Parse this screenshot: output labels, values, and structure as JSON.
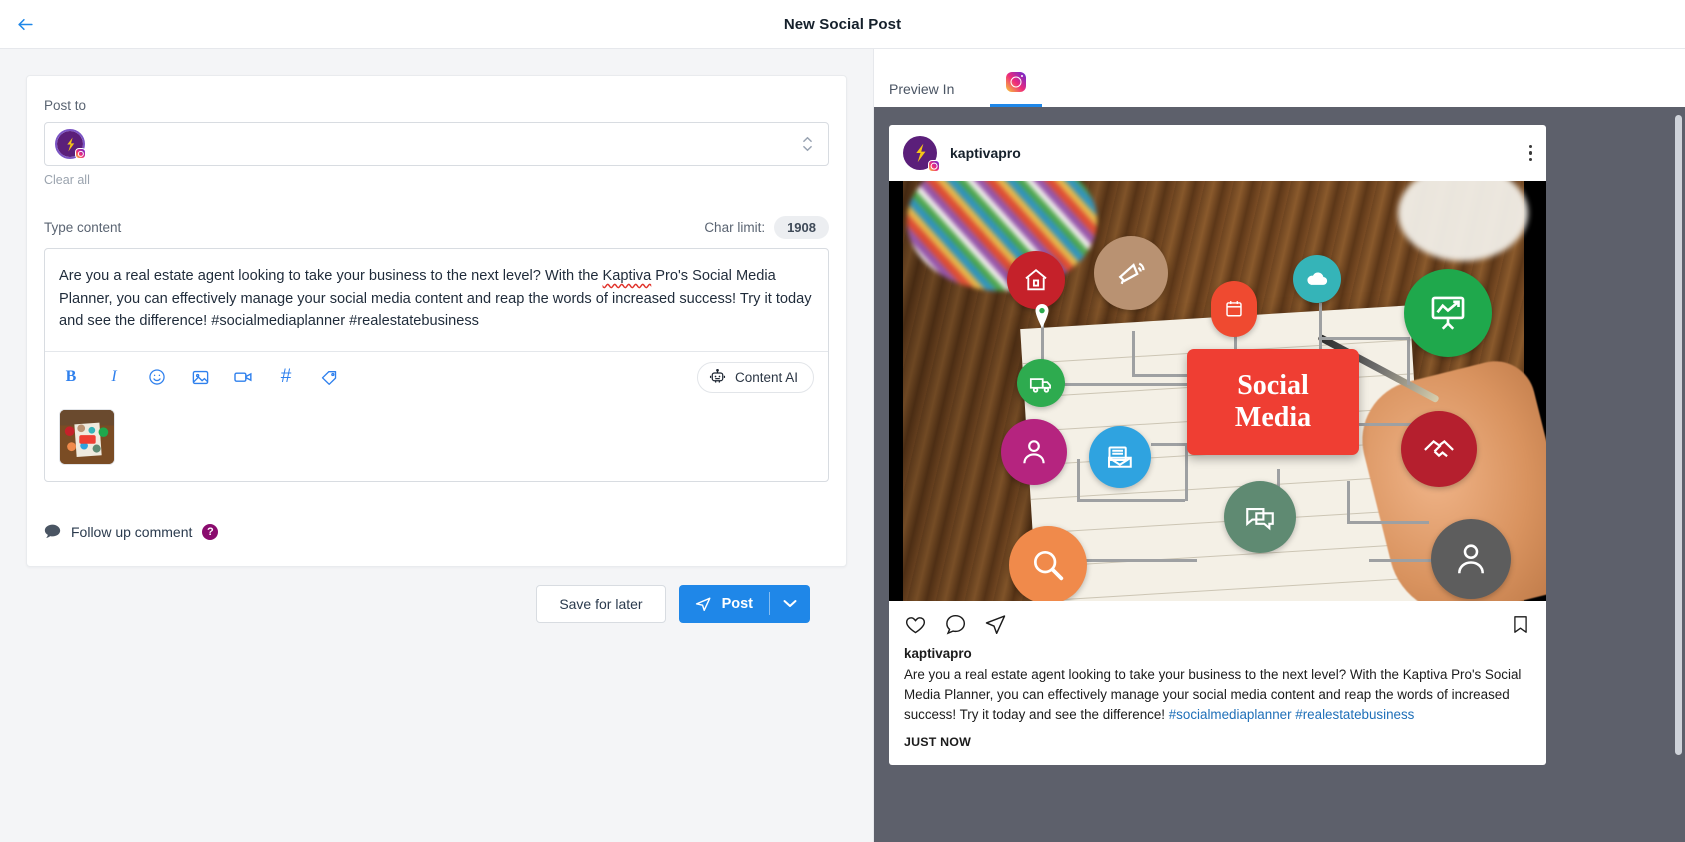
{
  "topbar": {
    "back_icon": "arrow-left-icon",
    "title": "New Social Post"
  },
  "composer": {
    "post_to_label": "Post to",
    "clear_all_label": "Clear all",
    "selected_account_icon": "kaptiva-avatar-instagram",
    "type_content_label": "Type content",
    "char_limit_label": "Char limit:",
    "char_limit_value": "1908",
    "content_text_part1": "Are you a real estate agent looking to take your business to the next level? With the ",
    "content_misspelled_word": "Kaptiva",
    "content_text_part2": " Pro's Social Media Planner, you can effectively manage your social media content and reap the words of increased success! Try it today and see the difference! #socialmediaplanner #realestatebusiness",
    "toolbar": [
      {
        "name": "bold-icon",
        "label": "B"
      },
      {
        "name": "italic-icon",
        "label": "I"
      },
      {
        "name": "emoji-icon",
        "label": ""
      },
      {
        "name": "image-icon",
        "label": ""
      },
      {
        "name": "video-icon",
        "label": ""
      },
      {
        "name": "hashtag-icon",
        "label": "#"
      },
      {
        "name": "tag-icon",
        "label": ""
      }
    ],
    "content_ai_label": "Content AI",
    "content_ai_icon": "robot-icon",
    "attachment_thumb_alt": "social-media-mindmap-thumbnail",
    "follow_up_label": "Follow up comment",
    "follow_up_icon": "speech-bubble-icon",
    "follow_up_help_badge": "?"
  },
  "actions": {
    "save_for_later_label": "Save for later",
    "post_label": "Post",
    "post_icon": "send-icon",
    "post_caret_icon": "chevron-down-icon"
  },
  "preview": {
    "preview_in_label": "Preview In",
    "tab_icon": "instagram-icon",
    "post": {
      "username": "kaptivapro",
      "menu_icon": "kebab-menu-icon",
      "caption_username": "kaptivapro",
      "caption_text": "Are you a real estate agent looking to take your business to the next level? With the Kaptiva Pro's Social Media Planner, you can effectively manage your social media content and reap the words of increased success! Try it today and see the difference! ",
      "caption_hashtags": "#socialmediaplanner #realestatebusiness",
      "timestamp": "JUST NOW",
      "actions": [
        {
          "name": "like-icon"
        },
        {
          "name": "comment-icon"
        },
        {
          "name": "share-icon"
        },
        {
          "name": "bookmark-icon"
        }
      ],
      "image": {
        "center_line1": "Social",
        "center_line2": "Media",
        "nodes": [
          {
            "name": "house-icon",
            "color": "#c5212a"
          },
          {
            "name": "megaphone-icon",
            "color": "#b99272"
          },
          {
            "name": "calendar-icon",
            "color": "#ef4a30"
          },
          {
            "name": "cloud-icon",
            "color": "#35b4b8"
          },
          {
            "name": "chart-board-icon",
            "color": "#1fa84c"
          },
          {
            "name": "truck-icon",
            "color": "#2eab4f"
          },
          {
            "name": "person-icon",
            "color": "#b5247f"
          },
          {
            "name": "email-icon",
            "color": "#2fa3e0"
          },
          {
            "name": "handshake-icon",
            "color": "#b51f2e"
          },
          {
            "name": "chat-icon",
            "color": "#5f8a72"
          },
          {
            "name": "search-icon",
            "color": "#f08a4b"
          },
          {
            "name": "avatar-icon",
            "color": "#5d5d5d"
          }
        ]
      }
    }
  },
  "colors": {
    "accent_blue": "#1f87e8",
    "brand_purple": "#5b1f7a",
    "page_bg": "#f4f5f7",
    "preview_stage": "#5d606b"
  }
}
